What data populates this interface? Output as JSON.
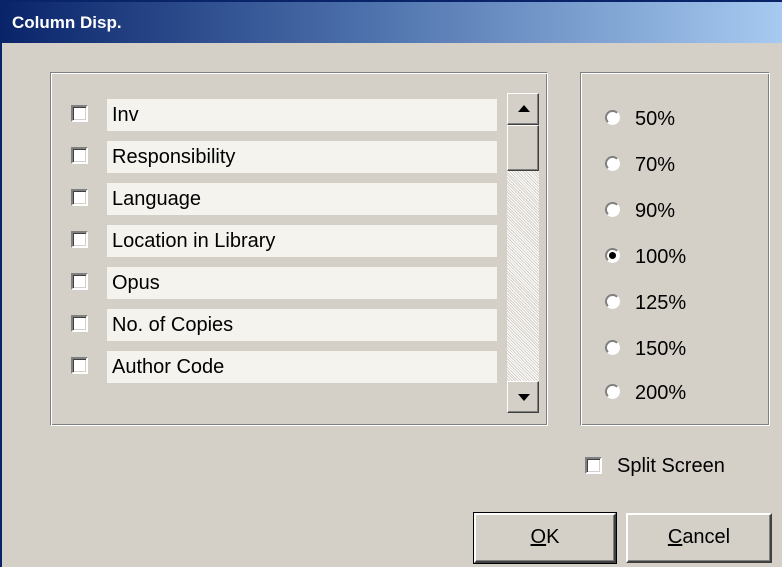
{
  "window": {
    "title": "Column Disp."
  },
  "columns": [
    {
      "label": "Inv",
      "checked": false
    },
    {
      "label": "Responsibility",
      "checked": false
    },
    {
      "label": "Language",
      "checked": false
    },
    {
      "label": "Location in Library",
      "checked": false
    },
    {
      "label": "Opus",
      "checked": false
    },
    {
      "label": "No. of Copies",
      "checked": false
    },
    {
      "label": "Author Code",
      "checked": false
    }
  ],
  "zoom": {
    "options": [
      "50%",
      "70%",
      "90%",
      "100%",
      "125%",
      "150%",
      "200%"
    ],
    "selected": "100%"
  },
  "split_screen": {
    "label": "Split Screen",
    "checked": false
  },
  "buttons": {
    "ok_label": "OK",
    "cancel_label": "Cancel"
  }
}
